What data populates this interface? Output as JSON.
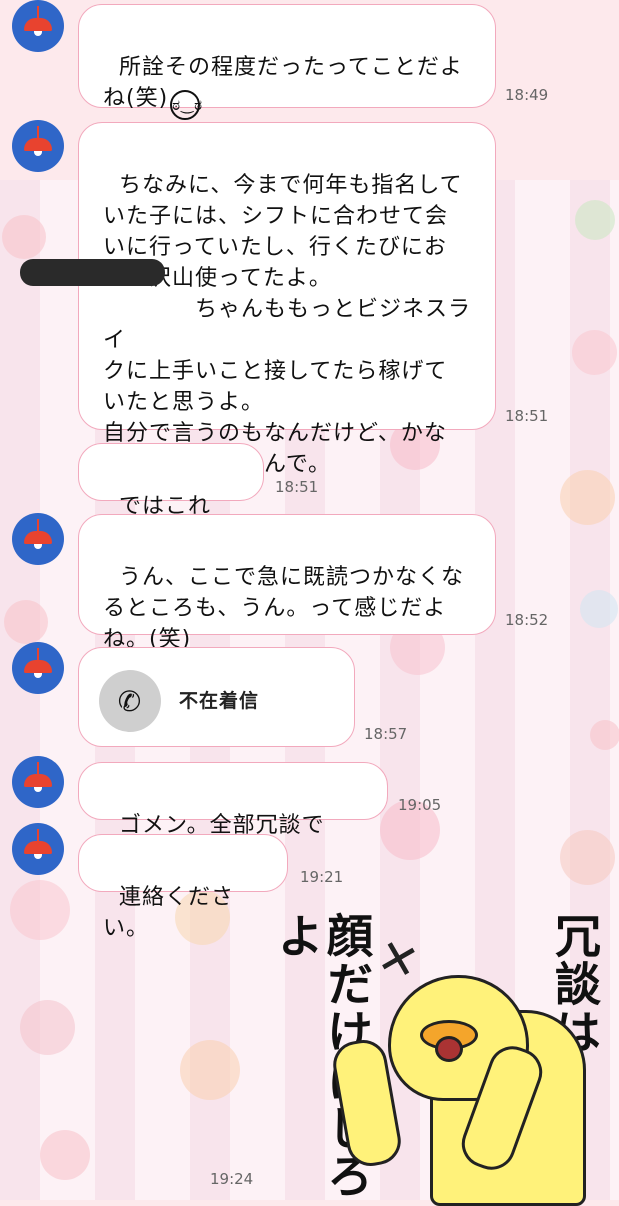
{
  "messages": [
    {
      "text": "所詮その程度だったってことだよ\nね(笑)",
      "emoji": "ಠ‿ಠ",
      "time": "18:49"
    },
    {
      "text": "ちなみに、今まで何年も指名して\nいた子には、シフトに合わせて会\nいに行っていたし、行くたびにお\n金も沢山使ってたよ。\n　　　　ちゃんももっとビジネスライ\nクに上手いこと接してたら稼げて\nいたと思うよ。\n自分で言うのもなんだけど、かな\nり太客だと思うんで。",
      "time": "18:51"
    },
    {
      "text": "ではこれで。",
      "time": "18:51"
    },
    {
      "text": "うん、ここで急に既読つかなくな\nるところも、うん。って感じだよ\nね。(笑)",
      "time": "18:52"
    },
    {
      "call_label": "不在着信",
      "call_icon": "phone-icon",
      "time": "18:57"
    },
    {
      "text": "ゴメン。全部冗談です。",
      "time": "19:05"
    },
    {
      "text": "連絡ください。",
      "time": "19:21"
    }
  ],
  "sticker": {
    "text_left": "顔だけにしろよ",
    "text_right": "冗談は",
    "time": "19:24"
  },
  "colors": {
    "avatar_bg": "#2f66c8",
    "lamp": "#e8432f",
    "bubble_border": "#f2a9bd",
    "chick": "#fff27a"
  }
}
